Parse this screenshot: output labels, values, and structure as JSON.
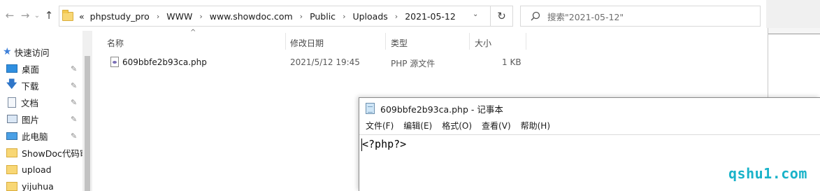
{
  "address_bar": {
    "overflow_glyph": "«",
    "path": [
      "phpstudy_pro",
      "WWW",
      "www.showdoc.com",
      "Public",
      "Uploads",
      "2021-05-12"
    ],
    "separator": "›",
    "dropdown_glyph": "⌄",
    "refresh_glyph": "↻",
    "back_glyph": "←",
    "forward_glyph": "→",
    "history_glyph": "⌄",
    "up_glyph": "↑"
  },
  "search": {
    "placeholder": "搜索\"2021-05-12\""
  },
  "nav_pane": {
    "items": [
      {
        "label": "快速访问",
        "icon": "star-icon",
        "pinned": false
      },
      {
        "label": "桌面",
        "icon": "desktop-icon",
        "pinned": true
      },
      {
        "label": "下载",
        "icon": "download-icon",
        "pinned": true
      },
      {
        "label": "文档",
        "icon": "documents-icon",
        "pinned": true
      },
      {
        "label": "图片",
        "icon": "pictures-icon",
        "pinned": true
      },
      {
        "label": "此电脑",
        "icon": "this-pc-icon",
        "pinned": true
      },
      {
        "label": "ShowDoc代码审",
        "icon": "folder-icon",
        "pinned": false
      },
      {
        "label": "upload",
        "icon": "folder-icon",
        "pinned": false
      },
      {
        "label": "yijuhua",
        "icon": "folder-icon",
        "pinned": false
      }
    ],
    "pin_glyph": "📌"
  },
  "file_list": {
    "sort_caret": "^",
    "columns": [
      "名称",
      "修改日期",
      "类型",
      "大小"
    ],
    "rows": [
      {
        "name": "609bbfe2b93ca.php",
        "modified": "2021/5/12 19:45",
        "type": "PHP 源文件",
        "size": "1 KB"
      }
    ]
  },
  "notepad": {
    "title": "609bbfe2b93ca.php - 记事本",
    "menu": [
      "文件(F)",
      "编辑(E)",
      "格式(O)",
      "查看(V)",
      "帮助(H)"
    ],
    "content": "<?php?>"
  },
  "watermark": "qshu1.com",
  "colors": {
    "accent": "#2f76c8",
    "watermark": "#19b3c9",
    "folder": "#f8d775"
  }
}
